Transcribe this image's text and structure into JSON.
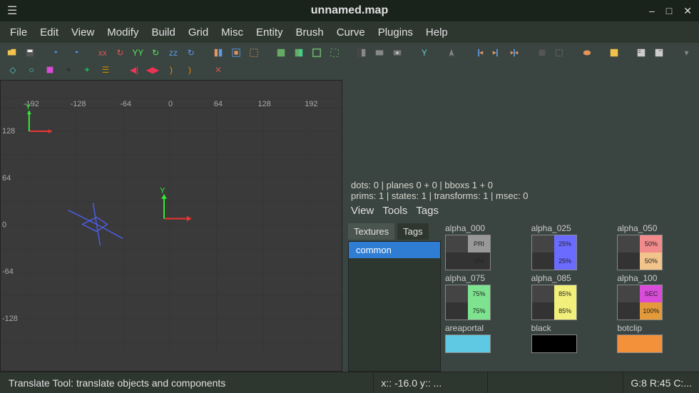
{
  "titlebar": {
    "title": "unnamed.map"
  },
  "menubar": [
    "File",
    "Edit",
    "View",
    "Modify",
    "Build",
    "Grid",
    "Misc",
    "Entity",
    "Brush",
    "Curve",
    "Plugins",
    "Help"
  ],
  "viewport": {
    "x_ticks": [
      -192,
      -128,
      -64,
      0,
      64,
      128,
      192
    ],
    "y_ticks": [
      128,
      64,
      0,
      -64,
      -128
    ]
  },
  "stats": {
    "line1": "dots: 0 | planes 0 + 0 | bboxs 1 + 0",
    "line2": "prims: 1 | states: 1 | transforms: 1 | msec: 0"
  },
  "panel_menu": [
    "View",
    "Tools",
    "Tags"
  ],
  "sidebar_tabs": [
    "Textures",
    "Tags"
  ],
  "tree_items": [
    "common"
  ],
  "textures": [
    {
      "name": "alpha_000",
      "colors": [
        "#444",
        "#999",
        "#333",
        "#333"
      ],
      "texts": [
        "",
        "PRI",
        "",
        "0%"
      ]
    },
    {
      "name": "alpha_025",
      "colors": [
        "#444",
        "#6b6cff",
        "#333",
        "#6b6cff"
      ],
      "texts": [
        "",
        "25%",
        "",
        "25%"
      ]
    },
    {
      "name": "alpha_050",
      "colors": [
        "#444",
        "#f28b8b",
        "#333",
        "#f2c38b"
      ],
      "texts": [
        "",
        "50%",
        "",
        "50%"
      ]
    },
    {
      "name": "alpha_075",
      "colors": [
        "#444",
        "#7de38f",
        "#333",
        "#7de38f"
      ],
      "texts": [
        "",
        "75%",
        "",
        "75%"
      ]
    },
    {
      "name": "alpha_085",
      "colors": [
        "#444",
        "#f2f07a",
        "#333",
        "#f2f07a"
      ],
      "texts": [
        "",
        "85%",
        "",
        "85%"
      ]
    },
    {
      "name": "alpha_100",
      "colors": [
        "#444",
        "#d94cd9",
        "#333",
        "#e39a3a"
      ],
      "texts": [
        "",
        "SEC",
        "",
        "100%"
      ]
    },
    {
      "name": "areaportal",
      "colors": [
        "#5fc9e3",
        "#5fc9e3"
      ],
      "texts": [
        "",
        ""
      ],
      "short": true
    },
    {
      "name": "black",
      "colors": [
        "#000",
        "#000"
      ],
      "texts": [
        "",
        ""
      ],
      "short": true
    },
    {
      "name": "botclip",
      "colors": [
        "#f2913a",
        "#f2913a"
      ],
      "texts": [
        "",
        ""
      ],
      "short": true
    }
  ],
  "statusbar": {
    "left": "Translate Tool: translate objects and components",
    "coords": "x::  -16.0  y:: ...",
    "grid": "G:8  R:45  C:..."
  }
}
